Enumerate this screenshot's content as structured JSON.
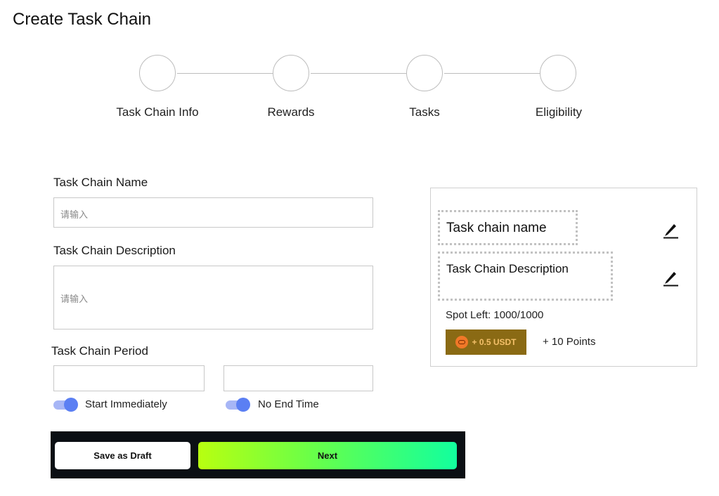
{
  "page": {
    "title": "Create Task Chain"
  },
  "stepper": {
    "steps": [
      {
        "label": "Task Chain Info"
      },
      {
        "label": "Rewards"
      },
      {
        "label": "Tasks"
      },
      {
        "label": "Eligibility"
      }
    ]
  },
  "form": {
    "name": {
      "label": "Task Chain Name",
      "placeholder": "请输入",
      "value": ""
    },
    "description": {
      "label": "Task Chain Description",
      "placeholder": "请输入",
      "value": ""
    },
    "period": {
      "label": "Task Chain Period",
      "start": {
        "value": "",
        "toggle_label": "Start Immediately",
        "toggle_on": true
      },
      "end": {
        "value": "",
        "toggle_label": "No End Time",
        "toggle_on": true
      }
    }
  },
  "actions": {
    "draft_label": "Save as Draft",
    "next_label": "Next"
  },
  "preview": {
    "name": "Task chain name",
    "description": "Task Chain Description",
    "spots": "Spot Left: 1000/1000",
    "reward_badge": "+ 0.5 USDT",
    "reward_points": "+ 10 Points",
    "icons": {
      "edit": "pencil-icon",
      "coin": "coin-icon"
    }
  },
  "colors": {
    "accent": "#5b7ff3",
    "toggle_track": "#a7b6f6",
    "action_bar": "#0b0f14",
    "next_gradient_start": "#b8ff10",
    "next_gradient_end": "#12ff9e",
    "badge_bg": "#8a6a14"
  }
}
